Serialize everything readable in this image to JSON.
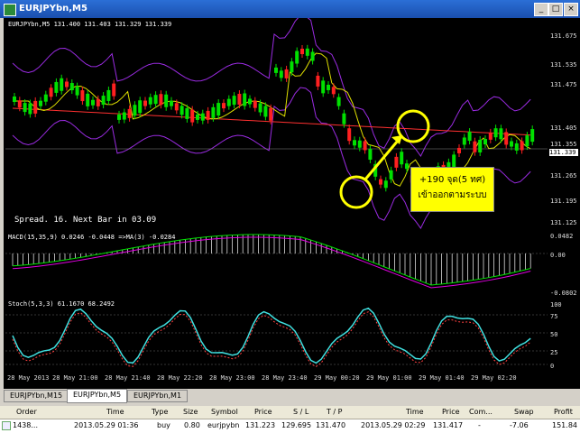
{
  "window": {
    "title": "EURJPYbn,M5"
  },
  "main": {
    "header": "EURJPYbn,M5  131.400 131.403 131.329 131.339",
    "spread_text": "Spread. 16. Next Bar in 03.09",
    "annotation_line1": "+190 จุด(5 ทศ)",
    "annotation_line2": "เข้าออกตามระบบ",
    "price_labels": [
      "131.675",
      "131.535",
      "131.475",
      "131.405",
      "131.355",
      "131.339",
      "131.265",
      "131.195",
      "131.125"
    ],
    "current_price": "131.339"
  },
  "macd": {
    "label": "MACD(15,35,9) 0.0246 -0.0448 =>MA(3) -0.0284",
    "labels": [
      "0.0482",
      "0.00",
      "-0.0802"
    ]
  },
  "stoch": {
    "label": "Stoch(5,3,3) 61.1670 68.2492",
    "labels": [
      "100",
      "75",
      "50",
      "25",
      "0"
    ]
  },
  "time_labels": [
    "28 May 2013",
    "28 May 21:00",
    "28 May 21:40",
    "28 May 22:20",
    "28 May 23:00",
    "28 May 23:40",
    "29 May 00:20",
    "29 May 01:00",
    "29 May 01:40",
    "29 May 02:20"
  ],
  "tabs": [
    "EURJPYbn,M15",
    "EURJPYbn,M5",
    "EURJPYbn,M1"
  ],
  "active_tab": "EURJPYbn,M5",
  "table": {
    "headers": [
      "Order",
      "Time",
      "Type",
      "Size",
      "Symbol",
      "Price",
      "S / L",
      "T / P",
      "Time",
      "Price",
      "Com...",
      "Swap",
      "Profit"
    ],
    "row": [
      "1438...",
      "2013.05.29 01:36",
      "buy",
      "0.80",
      "eurjpybn",
      "131.223",
      "129.695",
      "131.470",
      "2013.05.29 02:29",
      "131.417",
      "-",
      "-7.06",
      "151.84"
    ]
  },
  "colors": {
    "up": "#00e000",
    "down": "#ff2020",
    "bands": "#9a2be2",
    "ma_yellow": "#e0e000",
    "ma_red": "#ff3030",
    "annotation_bg": "#ffff00"
  },
  "icons": [
    "minimize-icon",
    "maximize-icon",
    "close-icon",
    "order-icon"
  ]
}
